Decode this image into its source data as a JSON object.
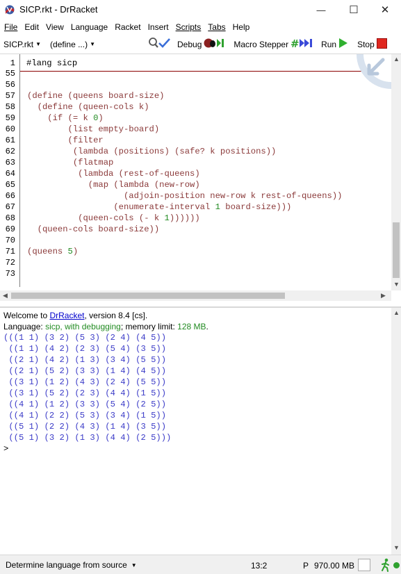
{
  "window": {
    "title": "SICP.rkt - DrRacket",
    "minimize": "—",
    "maximize": "☐",
    "close": "✕"
  },
  "menu": [
    "File",
    "Edit",
    "View",
    "Language",
    "Racket",
    "Insert",
    "Scripts",
    "Tabs",
    "Help"
  ],
  "toolbar": {
    "file_dropdown": "SICP.rkt",
    "define_dropdown": "(define ...)",
    "debug_label": "Debug",
    "macro_label": "Macro Stepper",
    "run_label": "Run",
    "stop_label": "Stop"
  },
  "editor": {
    "lang_line_no": "1",
    "lang_line": "#lang sicp",
    "line_numbers": [
      "55",
      "56",
      "57",
      "58",
      "59",
      "60",
      "61",
      "62",
      "63",
      "64",
      "65",
      "66",
      "67",
      "68",
      "69",
      "70",
      "71",
      "72",
      "73"
    ],
    "code": {
      "l57": "(define (queens board-size)",
      "l58": "  (define (queen-cols k)",
      "l59a": "    (if (= k ",
      "l59num": "0",
      "l59b": ")",
      "l60": "        (list empty-board)",
      "l61": "        (filter",
      "l62": "         (lambda (positions) (safe? k positions))",
      "l63": "         (flatmap",
      "l64": "          (lambda (rest-of-queens)",
      "l65": "            (map (lambda (new-row)",
      "l66": "                   (adjoin-position new-row k rest-of-queens))",
      "l67a": "                 (enumerate-interval ",
      "l67num": "1",
      "l67b": " board-size)))",
      "l68a": "          (queen-cols (- k ",
      "l68num": "1",
      "l68b": "))))))",
      "l69": "  (queen-cols board-size))",
      "l71a": "(queens ",
      "l71num": "5",
      "l71b": ")"
    }
  },
  "repl": {
    "welcome_prefix": "Welcome to ",
    "welcome_link": "DrRacket",
    "welcome_suffix": ", version 8.4 [cs].",
    "language_prefix": "Language: ",
    "language_name": "sicp, with debugging",
    "memory_prefix": "; memory limit: ",
    "memory_value": "128 MB",
    "memory_suffix": ".",
    "output": [
      "(((1 1) (3 2) (5 3) (2 4) (4 5))",
      " ((1 1) (4 2) (2 3) (5 4) (3 5))",
      " ((2 1) (4 2) (1 3) (3 4) (5 5))",
      " ((2 1) (5 2) (3 3) (1 4) (4 5))",
      " ((3 1) (1 2) (4 3) (2 4) (5 5))",
      " ((3 1) (5 2) (2 3) (4 4) (1 5))",
      " ((4 1) (1 2) (3 3) (5 4) (2 5))",
      " ((4 1) (2 2) (5 3) (3 4) (1 5))",
      " ((5 1) (2 2) (4 3) (1 4) (3 5))",
      " ((5 1) (3 2) (1 3) (4 4) (2 5)))"
    ],
    "prompt": ">"
  },
  "status": {
    "language_select": "Determine language from source",
    "position": "13:2",
    "memory_label": "P",
    "memory": "970.00 MB"
  }
}
